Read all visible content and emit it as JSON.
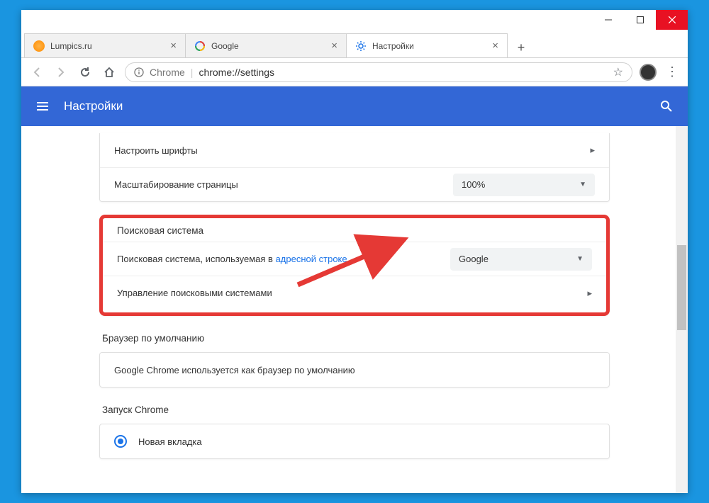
{
  "window_controls": {
    "minimize": "—",
    "maximize": "☐",
    "close": "✕"
  },
  "tabs": [
    {
      "title": "Lumpics.ru",
      "favicon_color": "#f7a物0"
    },
    {
      "title": "Google"
    },
    {
      "title": "Настройки"
    }
  ],
  "newtab_plus": "+",
  "nav": {
    "back": "←",
    "forward": "→",
    "reload": "↻",
    "home": "⌂"
  },
  "omnibox": {
    "secure_label": "Chrome",
    "url": "chrome://settings",
    "star": "☆",
    "menu": "⋮"
  },
  "settings_header": {
    "title": "Настройки"
  },
  "appearance": {
    "fonts_label": "Настроить шрифты",
    "zoom_label": "Масштабирование страницы",
    "zoom_value": "100%"
  },
  "search_engine": {
    "section_title": "Поисковая система",
    "row1_prefix": "Поисковая система, используемая в ",
    "row1_link": "адресной строке",
    "selected": "Google",
    "row2": "Управление поисковыми системами"
  },
  "default_browser": {
    "section_title": "Браузер по умолчанию",
    "text": "Google Chrome используется как браузер по умолчанию"
  },
  "on_startup": {
    "section_title": "Запуск Chrome",
    "option1": "Новая вкладка"
  }
}
